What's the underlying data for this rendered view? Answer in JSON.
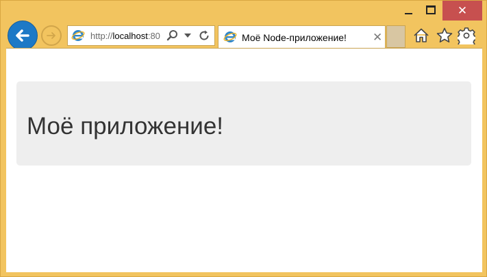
{
  "window": {
    "caption": {
      "minimize": "",
      "maximize": "",
      "close": "✕"
    }
  },
  "navigation": {
    "back_icon": "back-arrow-icon",
    "forward_icon": "forward-arrow-icon",
    "address": {
      "url_prefix": "http://",
      "url_host": "localhost",
      "url_rest": ":80",
      "search_icon": "magnifier-icon",
      "dropdown_icon": "caret-down-icon",
      "refresh_icon": "refresh-icon"
    }
  },
  "tab": {
    "title": "Моё Node-приложение!",
    "close": "✕"
  },
  "toolbar": {
    "home_icon": "home-icon",
    "favorites_icon": "star-icon",
    "tools_icon": "gear-icon"
  },
  "page": {
    "heading": "Моё приложение!"
  },
  "colors": {
    "frame": "#f2c45f",
    "close_button": "#c7504f",
    "back_button": "#1d79c6",
    "jumbotron": "#eeeeee",
    "heading_text": "#333333"
  }
}
